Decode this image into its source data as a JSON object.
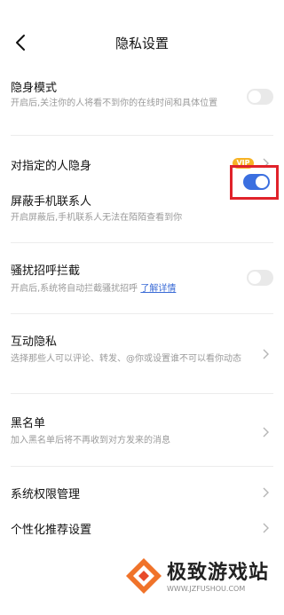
{
  "header": {
    "title": "隐私设置",
    "back_icon": "chevron-left-icon"
  },
  "items": [
    {
      "label": "隐身模式",
      "desc": "开启后,关注你的人将看不到你的在线时间和具体位置",
      "toggle": false
    },
    {
      "label": "对指定的人隐身",
      "badge": "VIP"
    },
    {
      "label": "屏蔽手机联系人",
      "desc": "开启屏蔽后,手机联系人无法在陌陌查看到你",
      "toggle": true
    },
    {
      "label": "骚扰招呼拦截",
      "desc": "开启后,系统将自动拦截骚扰招呼",
      "link": "了解详情",
      "toggle": false
    },
    {
      "label": "互动隐私",
      "desc": "选择那些人可以评论、转发、@你或设置谁不可以看你动态"
    },
    {
      "label": "黑名单",
      "desc": "加入黑名单后将不再收到对方发来的消息"
    },
    {
      "label": "系统权限管理"
    },
    {
      "label": "个性化推荐设置"
    }
  ],
  "watermark": {
    "name": "极致游戏站",
    "url": "WWW.JZFUSHOU.COM"
  },
  "colors": {
    "accent": "#3b6fe0",
    "highlight": "#e0222a",
    "vip": "#f7b325"
  }
}
